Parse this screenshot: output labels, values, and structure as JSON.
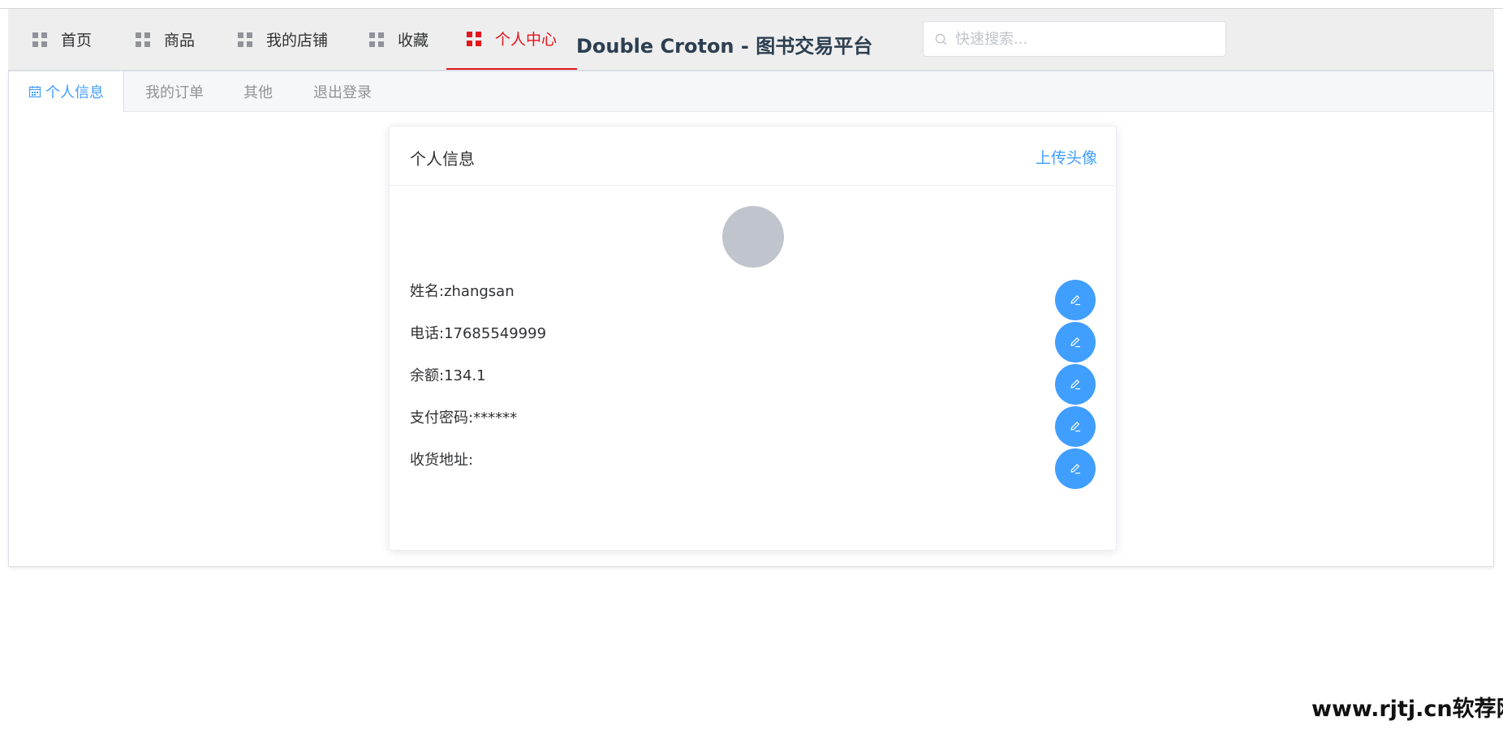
{
  "nav": {
    "items": [
      {
        "label": "首页",
        "icon": "grid-icon"
      },
      {
        "label": "商品",
        "icon": "grid-icon"
      },
      {
        "label": "我的店铺",
        "icon": "grid-icon"
      },
      {
        "label": "收藏",
        "icon": "grid-icon"
      },
      {
        "label": "个人中心",
        "icon": "grid-icon",
        "active": true
      }
    ],
    "site_title": "Double Croton - 图书交易平台",
    "search_placeholder": "快速搜索..."
  },
  "tabs": [
    {
      "label": "个人信息",
      "icon": "calendar-icon",
      "active": true
    },
    {
      "label": "我的订单"
    },
    {
      "label": "其他"
    },
    {
      "label": "退出登录"
    }
  ],
  "card": {
    "title": "个人信息",
    "upload_label": "上传头像",
    "fields": [
      {
        "text": "姓名:zhangsan"
      },
      {
        "text": "电话:17685549999"
      },
      {
        "text": "余额:134.1"
      },
      {
        "text": "支付密码:******"
      },
      {
        "text": "收货地址:"
      }
    ],
    "edit_icon": "edit-icon"
  },
  "watermark": "www.rjtj.cn软荐网",
  "colors": {
    "accent": "#409eff",
    "active_nav": "#e4151b",
    "avatar": "#c0c4cc"
  }
}
